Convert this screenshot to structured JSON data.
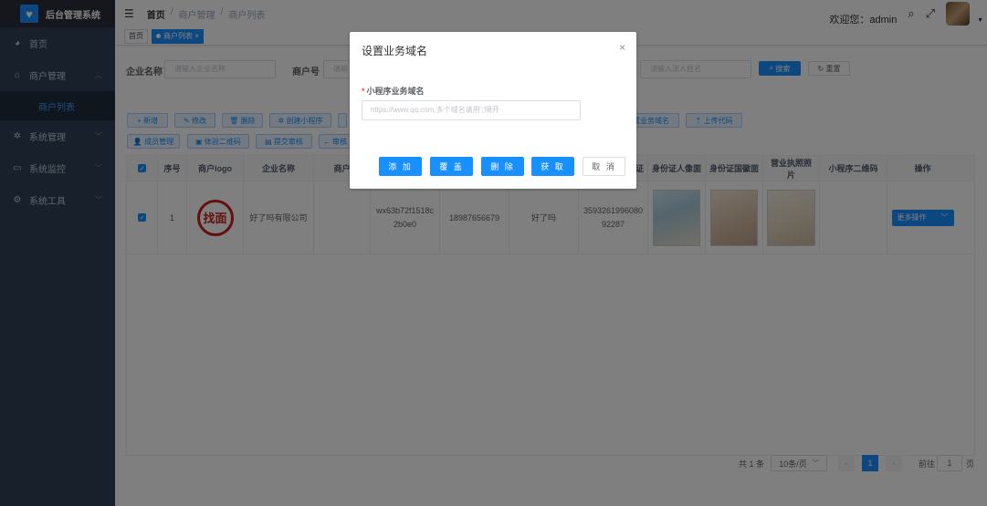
{
  "app": {
    "title": "后台管理系统"
  },
  "sidebar": {
    "items": [
      {
        "label": "首页",
        "icon": "dashboard-icon"
      },
      {
        "label": "商户管理",
        "icon": "shop-icon"
      },
      {
        "label": "商户列表"
      },
      {
        "label": "系统管理",
        "icon": "gear-icon"
      },
      {
        "label": "系统监控",
        "icon": "monitor-icon"
      },
      {
        "label": "系统工具",
        "icon": "tool-icon"
      }
    ]
  },
  "header": {
    "breadcrumb": [
      "首页",
      "/",
      "商户管理",
      "/",
      "商户列表"
    ],
    "welcome": "欢迎您：admin"
  },
  "tags": [
    {
      "label": "首页"
    },
    {
      "label": "商户列表 ×"
    }
  ],
  "search": {
    "company_label": "企业名称",
    "company_placeholder": "请输入企业名称",
    "merchant_label": "商户号",
    "merchant_placeholder": "请输",
    "legal_placeholder": "请输入法人姓名",
    "search_button": "搜索",
    "reset_button": "重置"
  },
  "toolbar": {
    "add": "新增",
    "edit": "修改",
    "delete": "删除",
    "create_miniapp": "创建小程序",
    "set_domain": "置业务域名",
    "upload_code": "上传代码",
    "members": "成员管理",
    "trial_qr": "体验二维码",
    "submit_audit": "提交审核",
    "review": "审核"
  },
  "table": {
    "headers": [
      "序号",
      "商户logo",
      "企业名称",
      "商户",
      "证",
      "身份证人像面",
      "身份证国徽面",
      "营业执照照片",
      "小程序二维码",
      "操作"
    ],
    "row": {
      "index": "1",
      "logo_text": "找面",
      "company": "好了吗有限公司",
      "appid": "wx63b72f1518c2b0e0",
      "phone": "18987656679",
      "name": "好了吗",
      "idcard": "359326199608092287",
      "more_btn": "更多操作"
    }
  },
  "pagination": {
    "total": "共 1 条",
    "page_size": "10条/页",
    "current_page": "1",
    "goto_label": "前往",
    "goto_value": "1",
    "page_suffix": "页"
  },
  "dialog": {
    "title": "设置业务域名",
    "field_label": "小程序业务域名",
    "placeholder": "https://www.qq.com,多个域名请用';'隔开",
    "buttons": [
      "添 加",
      "覆 盖",
      "删 除",
      "获 取",
      "取 消"
    ]
  }
}
